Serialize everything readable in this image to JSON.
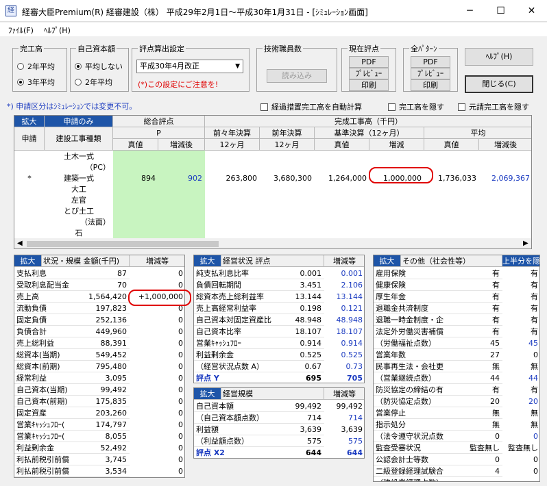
{
  "window": {
    "title": "経審大臣Premium(R)  経審建設（株）  平成29年2月1日～平成30年1月31日 - [ｼﾐｭﾚｰｼｮﾝ画面]",
    "icon": "app-icon",
    "minimize": "─",
    "maximize": "☐",
    "close": "✕"
  },
  "menu": {
    "file": "ﾌｧｲﾙ(F)",
    "help": "ﾍﾙﾌﾟ(H)"
  },
  "kanko": {
    "title": "完工高",
    "opt1": "2年平均",
    "opt2": "3年平均",
    "selected": 2
  },
  "jiko": {
    "title": "自己資本額",
    "opt1": "平均しない",
    "opt2": "2年平均",
    "selected": 1
  },
  "hyoten": {
    "title": "評点算出設定",
    "select_value": "平成30年4月改正",
    "note": "(*)この設定にご注意を!"
  },
  "gijutsu": {
    "title": "技術職員数",
    "button": "読み込み"
  },
  "genzai": {
    "title": "現在評点",
    "pdf": "PDF",
    "preview": "ﾌﾟﾚﾋﾞｭｰ",
    "print": "印刷"
  },
  "zen": {
    "title": "全ﾊﾟﾀｰﾝ",
    "pdf": "PDF",
    "preview": "ﾌﾟﾚﾋﾞｭｰ",
    "print": "印刷"
  },
  "help_button": "ﾍﾙﾌﾟ(H)",
  "close_button": "閉じる(C)",
  "notice": "*) 申請区分はｼﾐｭﾚｰｼｮﾝでは変更不可。",
  "checks": {
    "c1": "経過措置完工高を自動計算",
    "c2": "完工高を隠す",
    "c3": "元請完工高を隠す"
  },
  "grid": {
    "h_expand": "拡大",
    "h_mode": "申請のみ",
    "h_sogo": "総合評点",
    "h_kansei": "完成工事高（千円）",
    "h_shinsei": "申請",
    "h_shurui": "建設工事種類",
    "h_p": "P",
    "h_zenzen": "前々年決算",
    "h_zen": "前年決算",
    "h_kijun": "基準決算（12ヶ月）",
    "h_avg": "平均",
    "h_shinchi": "真値",
    "h_zougen_go": "増減後",
    "h_12a": "12ヶ月",
    "h_12b": "12ヶ月",
    "h_shinchi2": "真値",
    "h_zougen": "増減",
    "h_shinchi3": "真値",
    "h_zougen_go2": "増減後",
    "rows": [
      {
        "mark": "",
        "name": "土木一式",
        "p": "",
        "p2": "",
        "zz": "",
        "z": "",
        "k1": "",
        "k2": "",
        "a1": "",
        "a2": ""
      },
      {
        "mark": "",
        "name": "（PC）",
        "p": "",
        "p2": "",
        "zz": "",
        "z": "",
        "k1": "",
        "k2": "",
        "a1": "",
        "a2": ""
      },
      {
        "mark": "*",
        "name": "建築一式",
        "p": "894",
        "p2": "902",
        "zz": "263,800",
        "z": "3,680,300",
        "k1": "1,264,000",
        "k2": "1,000,000",
        "a1": "1,736,033",
        "a2": "2,069,367"
      },
      {
        "mark": "",
        "name": "大工",
        "p": "",
        "p2": "",
        "zz": "",
        "z": "",
        "k1": "",
        "k2": "",
        "a1": "",
        "a2": ""
      },
      {
        "mark": "",
        "name": "左官",
        "p": "",
        "p2": "",
        "zz": "",
        "z": "",
        "k1": "",
        "k2": "",
        "a1": "",
        "a2": ""
      },
      {
        "mark": "",
        "name": "とび土工",
        "p": "",
        "p2": "",
        "zz": "",
        "z": "",
        "k1": "",
        "k2": "",
        "a1": "",
        "a2": ""
      },
      {
        "mark": "",
        "name": "（法面）",
        "p": "",
        "p2": "",
        "zz": "",
        "z": "",
        "k1": "",
        "k2": "",
        "a1": "",
        "a2": ""
      },
      {
        "mark": "",
        "name": "石",
        "p": "",
        "p2": "",
        "zz": "",
        "z": "",
        "k1": "",
        "k2": "",
        "a1": "",
        "a2": ""
      }
    ]
  },
  "left_panel": {
    "expand": "拡大",
    "h1": "状況・規模 金額(千円)",
    "h2": "増減等",
    "rows": [
      {
        "label": "支払利息",
        "v": "87",
        "d": "0"
      },
      {
        "label": "受取利息配当金",
        "v": "70",
        "d": "0"
      },
      {
        "label": "売上高",
        "v": "1,564,420",
        "d": "+1,000,000"
      },
      {
        "label": "流動負債",
        "v": "197,823",
        "d": "0"
      },
      {
        "label": "固定負債",
        "v": "252,136",
        "d": "0"
      },
      {
        "label": "負債合計",
        "v": "449,960",
        "d": "0"
      },
      {
        "label": "売上総利益",
        "v": "88,391",
        "d": "0"
      },
      {
        "label": "総資本(当期)",
        "v": "549,452",
        "d": "0"
      },
      {
        "label": "総資本(前期)",
        "v": "795,480",
        "d": "0"
      },
      {
        "label": "経常利益",
        "v": "3,095",
        "d": "0"
      },
      {
        "label": "自己資本(当期)",
        "v": "99,492",
        "d": "0"
      },
      {
        "label": "自己資本(前期)",
        "v": "175,835",
        "d": "0"
      },
      {
        "label": "固定資産",
        "v": "203,260",
        "d": "0"
      },
      {
        "label": "営業ｷｬｯｼｭﾌﾛｰ(",
        "v": "174,797",
        "d": "0"
      },
      {
        "label": "営業ｷｬｯｼｭﾌﾛｰ(",
        "v": "8,055",
        "d": "0"
      },
      {
        "label": "利益剰余金",
        "v": "52,492",
        "d": "0"
      },
      {
        "label": "利払前税引前償",
        "v": "3,745",
        "d": "0"
      },
      {
        "label": "利払前税引前償",
        "v": "3,534",
        "d": "0"
      }
    ]
  },
  "mid_panel": {
    "expand": "拡大",
    "h1": "経営状況  評点",
    "h2": "増減等",
    "rows": [
      {
        "label": "純支払利息比率",
        "v": "0.001",
        "d": "0.001",
        "blue": true
      },
      {
        "label": "負債回転期間",
        "v": "3.451",
        "d": "2.106",
        "blue": true
      },
      {
        "label": "総資本売上総利益率",
        "v": "13.144",
        "d": "13.144",
        "blue": true
      },
      {
        "label": "売上高経常利益率",
        "v": "0.198",
        "d": "0.121",
        "blue": true
      },
      {
        "label": "自己資本対固定資産比",
        "v": "48.948",
        "d": "48.948",
        "blue": true
      },
      {
        "label": "自己資本比率",
        "v": "18.107",
        "d": "18.107",
        "blue": true
      },
      {
        "label": "営業ｷｬｯｼｭﾌﾛｰ",
        "v": "0.914",
        "d": "0.914",
        "blue": true
      },
      {
        "label": "利益剰余金",
        "v": "0.525",
        "d": "0.525",
        "blue": true
      },
      {
        "label": "（経営状況点数 A）",
        "v": "0.67",
        "d": "0.73",
        "blue": true
      },
      {
        "label": "評点 Y",
        "v": "695",
        "d": "705",
        "bold": true
      }
    ]
  },
  "mid2_panel": {
    "expand": "拡大",
    "h1": "経営規模",
    "h2": "増減等",
    "rows": [
      {
        "label": "自己資本額",
        "v": "99,492",
        "d": "99,492"
      },
      {
        "label": "（自己資本額点数）",
        "v": "714",
        "d": "714",
        "blue": true
      },
      {
        "label": "利益額",
        "v": "3,639",
        "d": "3,639"
      },
      {
        "label": "（利益額点数）",
        "v": "575",
        "d": "575",
        "blue": true
      },
      {
        "label": "評点 X2",
        "v": "644",
        "d": "644",
        "bold": true
      }
    ]
  },
  "right_panel": {
    "expand": "拡大",
    "h1": "その他（社会性等）",
    "h2": "上半分を隠す",
    "rows": [
      {
        "label": "雇用保険",
        "v": "有",
        "d": "有"
      },
      {
        "label": "健康保険",
        "v": "有",
        "d": "有"
      },
      {
        "label": "厚生年金",
        "v": "有",
        "d": "有"
      },
      {
        "label": "退職金共済制度",
        "v": "有",
        "d": "有"
      },
      {
        "label": "退職一時金制度・企",
        "v": "有",
        "d": "有"
      },
      {
        "label": "法定外労働災害補償",
        "v": "有",
        "d": "有"
      },
      {
        "label": "（労働福祉点数）",
        "v": "45",
        "d": "45",
        "blue": true
      },
      {
        "label": "営業年数",
        "v": "27",
        "d": "0"
      },
      {
        "label": "民事再生法・会社更",
        "v": "無",
        "d": "無"
      },
      {
        "label": "（営業継続点数）",
        "v": "44",
        "d": "44",
        "blue": true
      },
      {
        "label": "防災協定の締結の有",
        "v": "有",
        "d": "有"
      },
      {
        "label": "（防災協定点数）",
        "v": "20",
        "d": "20",
        "blue": true
      },
      {
        "label": "営業停止",
        "v": "無",
        "d": "無"
      },
      {
        "label": "指示処分",
        "v": "無",
        "d": "無"
      },
      {
        "label": "（法令遵守状況点数",
        "v": "0",
        "d": "0",
        "blue": true
      },
      {
        "label": "監査受審状況",
        "v": "監査無し",
        "d": "監査無し"
      },
      {
        "label": "公認会計士等数",
        "v": "0",
        "d": "0"
      },
      {
        "label": "二級登録経理試験合",
        "v": "4",
        "d": "0"
      },
      {
        "label": "（建設業経理点数）",
        "v": "",
        "d": ""
      }
    ]
  }
}
